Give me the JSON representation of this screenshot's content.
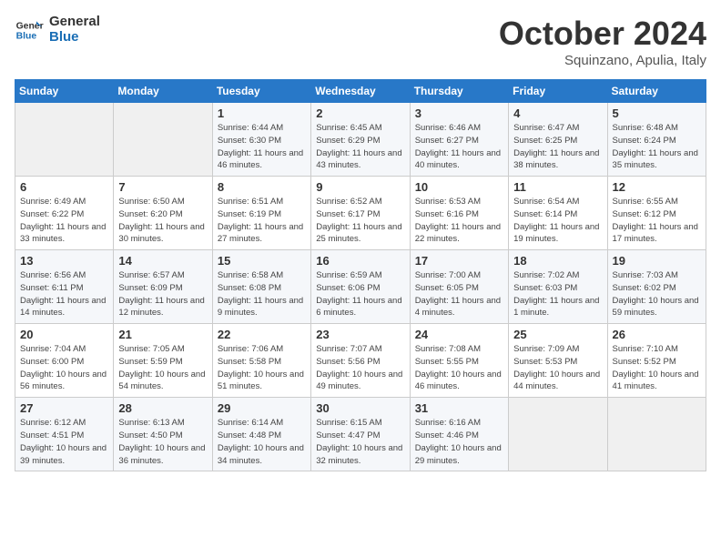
{
  "header": {
    "logo_general": "General",
    "logo_blue": "Blue",
    "month": "October 2024",
    "location": "Squinzano, Apulia, Italy"
  },
  "weekdays": [
    "Sunday",
    "Monday",
    "Tuesday",
    "Wednesday",
    "Thursday",
    "Friday",
    "Saturday"
  ],
  "weeks": [
    [
      {
        "day": "",
        "info": ""
      },
      {
        "day": "",
        "info": ""
      },
      {
        "day": "1",
        "info": "Sunrise: 6:44 AM\nSunset: 6:30 PM\nDaylight: 11 hours and 46 minutes."
      },
      {
        "day": "2",
        "info": "Sunrise: 6:45 AM\nSunset: 6:29 PM\nDaylight: 11 hours and 43 minutes."
      },
      {
        "day": "3",
        "info": "Sunrise: 6:46 AM\nSunset: 6:27 PM\nDaylight: 11 hours and 40 minutes."
      },
      {
        "day": "4",
        "info": "Sunrise: 6:47 AM\nSunset: 6:25 PM\nDaylight: 11 hours and 38 minutes."
      },
      {
        "day": "5",
        "info": "Sunrise: 6:48 AM\nSunset: 6:24 PM\nDaylight: 11 hours and 35 minutes."
      }
    ],
    [
      {
        "day": "6",
        "info": "Sunrise: 6:49 AM\nSunset: 6:22 PM\nDaylight: 11 hours and 33 minutes."
      },
      {
        "day": "7",
        "info": "Sunrise: 6:50 AM\nSunset: 6:20 PM\nDaylight: 11 hours and 30 minutes."
      },
      {
        "day": "8",
        "info": "Sunrise: 6:51 AM\nSunset: 6:19 PM\nDaylight: 11 hours and 27 minutes."
      },
      {
        "day": "9",
        "info": "Sunrise: 6:52 AM\nSunset: 6:17 PM\nDaylight: 11 hours and 25 minutes."
      },
      {
        "day": "10",
        "info": "Sunrise: 6:53 AM\nSunset: 6:16 PM\nDaylight: 11 hours and 22 minutes."
      },
      {
        "day": "11",
        "info": "Sunrise: 6:54 AM\nSunset: 6:14 PM\nDaylight: 11 hours and 19 minutes."
      },
      {
        "day": "12",
        "info": "Sunrise: 6:55 AM\nSunset: 6:12 PM\nDaylight: 11 hours and 17 minutes."
      }
    ],
    [
      {
        "day": "13",
        "info": "Sunrise: 6:56 AM\nSunset: 6:11 PM\nDaylight: 11 hours and 14 minutes."
      },
      {
        "day": "14",
        "info": "Sunrise: 6:57 AM\nSunset: 6:09 PM\nDaylight: 11 hours and 12 minutes."
      },
      {
        "day": "15",
        "info": "Sunrise: 6:58 AM\nSunset: 6:08 PM\nDaylight: 11 hours and 9 minutes."
      },
      {
        "day": "16",
        "info": "Sunrise: 6:59 AM\nSunset: 6:06 PM\nDaylight: 11 hours and 6 minutes."
      },
      {
        "day": "17",
        "info": "Sunrise: 7:00 AM\nSunset: 6:05 PM\nDaylight: 11 hours and 4 minutes."
      },
      {
        "day": "18",
        "info": "Sunrise: 7:02 AM\nSunset: 6:03 PM\nDaylight: 11 hours and 1 minute."
      },
      {
        "day": "19",
        "info": "Sunrise: 7:03 AM\nSunset: 6:02 PM\nDaylight: 10 hours and 59 minutes."
      }
    ],
    [
      {
        "day": "20",
        "info": "Sunrise: 7:04 AM\nSunset: 6:00 PM\nDaylight: 10 hours and 56 minutes."
      },
      {
        "day": "21",
        "info": "Sunrise: 7:05 AM\nSunset: 5:59 PM\nDaylight: 10 hours and 54 minutes."
      },
      {
        "day": "22",
        "info": "Sunrise: 7:06 AM\nSunset: 5:58 PM\nDaylight: 10 hours and 51 minutes."
      },
      {
        "day": "23",
        "info": "Sunrise: 7:07 AM\nSunset: 5:56 PM\nDaylight: 10 hours and 49 minutes."
      },
      {
        "day": "24",
        "info": "Sunrise: 7:08 AM\nSunset: 5:55 PM\nDaylight: 10 hours and 46 minutes."
      },
      {
        "day": "25",
        "info": "Sunrise: 7:09 AM\nSunset: 5:53 PM\nDaylight: 10 hours and 44 minutes."
      },
      {
        "day": "26",
        "info": "Sunrise: 7:10 AM\nSunset: 5:52 PM\nDaylight: 10 hours and 41 minutes."
      }
    ],
    [
      {
        "day": "27",
        "info": "Sunrise: 6:12 AM\nSunset: 4:51 PM\nDaylight: 10 hours and 39 minutes."
      },
      {
        "day": "28",
        "info": "Sunrise: 6:13 AM\nSunset: 4:50 PM\nDaylight: 10 hours and 36 minutes."
      },
      {
        "day": "29",
        "info": "Sunrise: 6:14 AM\nSunset: 4:48 PM\nDaylight: 10 hours and 34 minutes."
      },
      {
        "day": "30",
        "info": "Sunrise: 6:15 AM\nSunset: 4:47 PM\nDaylight: 10 hours and 32 minutes."
      },
      {
        "day": "31",
        "info": "Sunrise: 6:16 AM\nSunset: 4:46 PM\nDaylight: 10 hours and 29 minutes."
      },
      {
        "day": "",
        "info": ""
      },
      {
        "day": "",
        "info": ""
      }
    ]
  ]
}
